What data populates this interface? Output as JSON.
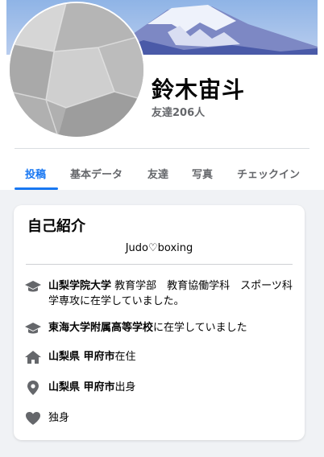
{
  "profile": {
    "name": "鈴木宙斗",
    "friends": "友達206人"
  },
  "tabs": [
    {
      "label": "投稿",
      "active": true
    },
    {
      "label": "基本データ",
      "active": false
    },
    {
      "label": "友達",
      "active": false
    },
    {
      "label": "写真",
      "active": false
    },
    {
      "label": "チェックイン",
      "active": false
    }
  ],
  "intro": {
    "title": "自己紹介",
    "bio": "Judo♡boxing",
    "items": [
      {
        "icon": "graduation-cap-icon",
        "bold": "山梨学院大学",
        "text": " 教育学部　教育協働学科　スポーツ科学専攻に在学していました。"
      },
      {
        "icon": "graduation-cap-icon",
        "bold": "東海大学附属高等学校",
        "text": "に在学していました"
      },
      {
        "icon": "home-icon",
        "bold": "山梨県 甲府市",
        "text": "在住"
      },
      {
        "icon": "location-pin-icon",
        "bold": "山梨県 甲府市",
        "text": "出身"
      },
      {
        "icon": "heart-icon",
        "bold": "",
        "text": "独身"
      }
    ]
  },
  "colors": {
    "accent": "#1877f2",
    "secondary_text": "#65676b",
    "background": "#f0f2f5"
  }
}
